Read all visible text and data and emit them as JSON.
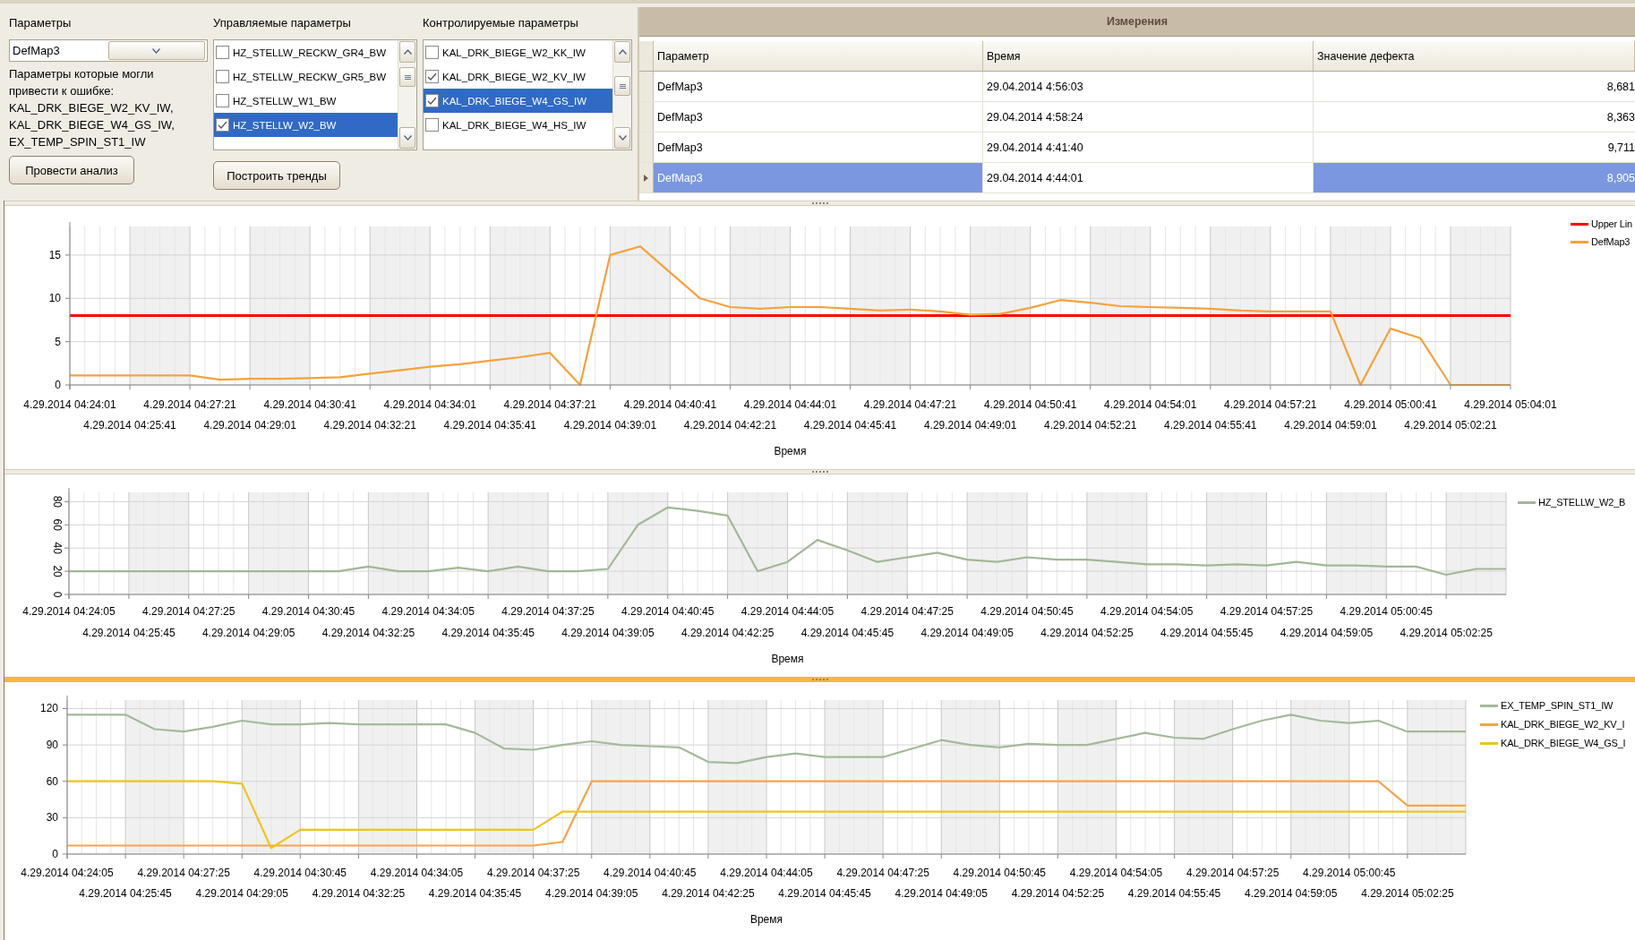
{
  "parameters": {
    "label": "Параметры",
    "combo_value": "DefMap3",
    "hint": "Параметры которые могли привести к ошибке:",
    "suspects": [
      "KAL_DRK_BIEGE_W2_KV_IW,",
      "KAL_DRK_BIEGE_W4_GS_IW,",
      "EX_TEMP_SPIN_ST1_IW"
    ],
    "button": "Провести анализ"
  },
  "controlled": {
    "label": "Управляемые параметры",
    "items": [
      {
        "label": "HZ_STELLW_RECKW_GR4_BW",
        "checked": false,
        "selected": false
      },
      {
        "label": "HZ_STELLW_RECKW_GR5_BW",
        "checked": false,
        "selected": false
      },
      {
        "label": "HZ_STELLW_W1_BW",
        "checked": false,
        "selected": false
      },
      {
        "label": "HZ_STELLW_W2_BW",
        "checked": true,
        "selected": true
      }
    ],
    "button": "Построить тренды"
  },
  "monitored": {
    "label": "Контролируемые параметры",
    "items": [
      {
        "label": "KAL_DRK_BIEGE_W2_KK_IW",
        "checked": false,
        "selected": false
      },
      {
        "label": "KAL_DRK_BIEGE_W2_KV_IW",
        "checked": true,
        "selected": false
      },
      {
        "label": "KAL_DRK_BIEGE_W4_GS_IW",
        "checked": true,
        "selected": true
      },
      {
        "label": "KAL_DRK_BIEGE_W4_HS_IW",
        "checked": false,
        "selected": false
      }
    ]
  },
  "measurements": {
    "title": "Измерения",
    "columns": [
      "Параметр",
      "Время",
      "Значение дефекта"
    ],
    "rows": [
      {
        "cells": [
          "DefMap3",
          "29.04.2014 4:56:03",
          "8,681"
        ],
        "selected": false
      },
      {
        "cells": [
          "DefMap3",
          "29.04.2014 4:58:24",
          "8,363"
        ],
        "selected": false
      },
      {
        "cells": [
          "DefMap3",
          "29.04.2014 4:41:40",
          "9,711"
        ],
        "selected": false
      },
      {
        "cells": [
          "DefMap3",
          "29.04.2014 4:44:01",
          "8,905"
        ],
        "selected": true
      }
    ]
  },
  "charts": [
    {
      "chart_data": {
        "type": "line",
        "grid": true,
        "xlabel": "Время",
        "ylim": [
          0,
          18.3
        ],
        "yticks": [
          0,
          5,
          10,
          15
        ],
        "categories": [
          "4.29.2014 04:24:01",
          null,
          "4.29.2014 04:25:41",
          null,
          "4.29.2014 04:27:21",
          null,
          "4.29.2014 04:29:01",
          null,
          "4.29.2014 04:30:41",
          null,
          "4.29.2014 04:32:21",
          null,
          "4.29.2014 04:34:01",
          null,
          "4.29.2014 04:35:41",
          null,
          "4.29.2014 04:37:21",
          null,
          "4.29.2014 04:39:01",
          null,
          "4.29.2014 04:40:41",
          null,
          "4.29.2014 04:42:21",
          null,
          "4.29.2014 04:44:01",
          null,
          "4.29.2014 04:45:41",
          null,
          "4.29.2014 04:47:21",
          null,
          "4.29.2014 04:49:01",
          null,
          "4.29.2014 04:50:41",
          null,
          "4.29.2014 04:52:21",
          null,
          "4.29.2014 04:54:01",
          null,
          "4.29.2014 04:55:41",
          null,
          "4.29.2014 04:57:21",
          null,
          "4.29.2014 04:59:01",
          null,
          "4.29.2014 05:00:41",
          null,
          "4.29.2014 05:02:21",
          null,
          "4.29.2014 05:04:01"
        ],
        "series": [
          {
            "name": "Upper Lin",
            "color": "#ff0000",
            "values": [
              8,
              8,
              8,
              8,
              8,
              8,
              8,
              8,
              8,
              8,
              8,
              8,
              8,
              8,
              8,
              8,
              8,
              8,
              8,
              8,
              8,
              8,
              8,
              8,
              8,
              8,
              8,
              8,
              8,
              8,
              8,
              8,
              8,
              8,
              8,
              8,
              8,
              8,
              8,
              8,
              8,
              8,
              8,
              8,
              8,
              8,
              8,
              8,
              8
            ]
          },
          {
            "name": "DefMap3",
            "color": "#f5a23c",
            "values": [
              1.1,
              1.1,
              1.1,
              1.1,
              1.1,
              0.6,
              0.7,
              0.7,
              0.8,
              0.9,
              1.3,
              1.7,
              2.1,
              2.4,
              2.8,
              3.2,
              3.7,
              0,
              15,
              16,
              13,
              10,
              9,
              8.8,
              9,
              9,
              8.8,
              8.6,
              8.7,
              8.5,
              8.1,
              8.2,
              8.9,
              9.8,
              9.5,
              9.1,
              9,
              8.9,
              8.8,
              8.6,
              8.5,
              8.5,
              8.5,
              0,
              6.5,
              5.4,
              0,
              0,
              0
            ]
          }
        ]
      }
    },
    {
      "chart_data": {
        "type": "line",
        "grid": true,
        "xlabel": "Время",
        "ylim": [
          0,
          88
        ],
        "yticks": [
          0,
          20,
          40,
          60,
          80
        ],
        "categories": [
          "4.29.2014 04:24:05",
          null,
          "4.29.2014 04:25:45",
          null,
          "4.29.2014 04:27:25",
          null,
          "4.29.2014 04:29:05",
          null,
          "4.29.2014 04:30:45",
          null,
          "4.29.2014 04:32:25",
          null,
          "4.29.2014 04:34:05",
          null,
          "4.29.2014 04:35:45",
          null,
          "4.29.2014 04:37:25",
          null,
          "4.29.2014 04:39:05",
          null,
          "4.29.2014 04:40:45",
          null,
          "4.29.2014 04:42:25",
          null,
          "4.29.2014 04:44:05",
          null,
          "4.29.2014 04:45:45",
          null,
          "4.29.2014 04:47:25",
          null,
          "4.29.2014 04:49:05",
          null,
          "4.29.2014 04:50:45",
          null,
          "4.29.2014 04:52:25",
          null,
          "4.29.2014 04:54:05",
          null,
          "4.29.2014 04:55:45",
          null,
          "4.29.2014 04:57:25",
          null,
          "4.29.2014 04:59:05",
          null,
          "4.29.2014 05:00:45",
          null,
          "4.29.2014 05:02:25",
          null,
          null
        ],
        "series": [
          {
            "name": "HZ_STELLW_W2_B",
            "color": "#a3b797",
            "values": [
              20,
              20,
              20,
              20,
              20,
              20,
              20,
              20,
              20,
              20,
              24,
              20,
              20,
              23,
              20,
              24,
              20,
              20,
              22,
              60,
              75,
              72,
              68,
              20,
              28,
              47,
              38,
              28,
              32,
              36,
              30,
              28,
              32,
              30,
              30,
              28,
              26,
              26,
              25,
              26,
              25,
              28,
              25,
              25,
              24,
              24,
              17,
              22,
              22
            ]
          }
        ]
      }
    },
    {
      "chart_data": {
        "type": "line",
        "grid": true,
        "xlabel": "Время",
        "ylim": [
          0,
          127
        ],
        "yticks": [
          0,
          30,
          60,
          90,
          120
        ],
        "categories": [
          "4.29.2014 04:24:05",
          null,
          "4.29.2014 04:25:45",
          null,
          "4.29.2014 04:27:25",
          null,
          "4.29.2014 04:29:05",
          null,
          "4.29.2014 04:30:45",
          null,
          "4.29.2014 04:32:25",
          null,
          "4.29.2014 04:34:05",
          null,
          "4.29.2014 04:35:45",
          null,
          "4.29.2014 04:37:25",
          null,
          "4.29.2014 04:39:05",
          null,
          "4.29.2014 04:40:45",
          null,
          "4.29.2014 04:42:25",
          null,
          "4.29.2014 04:44:05",
          null,
          "4.29.2014 04:45:45",
          null,
          "4.29.2014 04:47:25",
          null,
          "4.29.2014 04:49:05",
          null,
          "4.29.2014 04:50:45",
          null,
          "4.29.2014 04:52:25",
          null,
          "4.29.2014 04:54:05",
          null,
          "4.29.2014 04:55:45",
          null,
          "4.29.2014 04:57:25",
          null,
          "4.29.2014 04:59:05",
          null,
          "4.29.2014 05:00:45",
          null,
          "4.29.2014 05:02:25",
          null,
          null
        ],
        "series": [
          {
            "name": "EX_TEMP_SPIN_ST1_IW",
            "color": "#a5b99b",
            "values": [
              115,
              115,
              115,
              103,
              101,
              105,
              110,
              107,
              107,
              108,
              107,
              107,
              107,
              107,
              100,
              87,
              86,
              90,
              93,
              90,
              89,
              88,
              76,
              75,
              80,
              83,
              80,
              80,
              80,
              87,
              94,
              90,
              88,
              91,
              90,
              90,
              95,
              100,
              96,
              95,
              103,
              110,
              115,
              110,
              108,
              110,
              101,
              101,
              101
            ]
          },
          {
            "name": "KAL_DRK_BIEGE_W2_KV_I",
            "color": "#f5a54a",
            "values": [
              7,
              7,
              7,
              7,
              7,
              7,
              7,
              7,
              7,
              7,
              7,
              7,
              7,
              7,
              7,
              7,
              7,
              10,
              60,
              60,
              60,
              60,
              60,
              60,
              60,
              60,
              60,
              60,
              60,
              60,
              60,
              60,
              60,
              60,
              60,
              60,
              60,
              60,
              60,
              60,
              60,
              60,
              60,
              60,
              60,
              60,
              40,
              40,
              40
            ]
          },
          {
            "name": "KAL_DRK_BIEGE_W4_GS_I",
            "color": "#f0c419",
            "values": [
              60,
              60,
              60,
              60,
              60,
              60,
              58,
              5,
              20,
              20,
              20,
              20,
              20,
              20,
              20,
              20,
              20,
              35,
              35,
              35,
              35,
              35,
              35,
              35,
              35,
              35,
              35,
              35,
              35,
              35,
              35,
              35,
              35,
              35,
              35,
              35,
              35,
              35,
              35,
              35,
              35,
              35,
              35,
              35,
              35,
              35,
              35,
              35,
              35
            ]
          }
        ]
      }
    }
  ]
}
